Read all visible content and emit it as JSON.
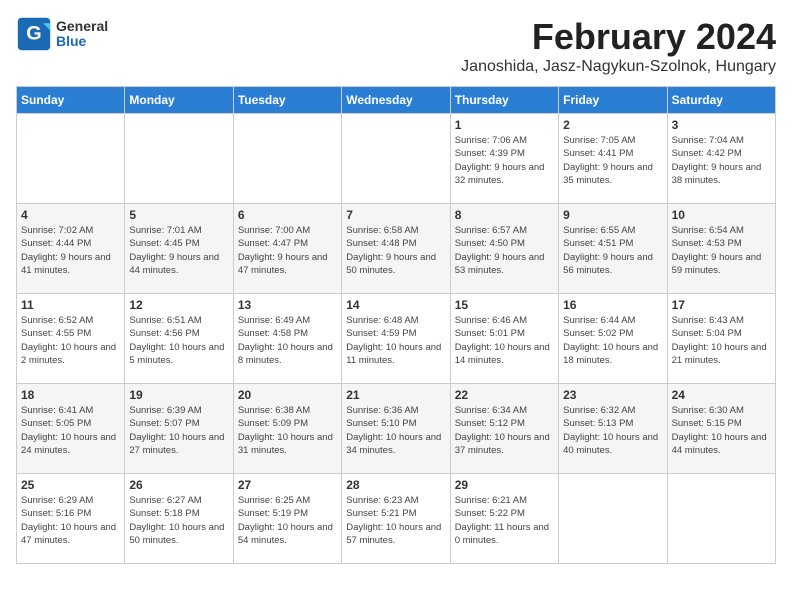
{
  "header": {
    "logo_general": "General",
    "logo_blue": "Blue",
    "month_title": "February 2024",
    "location": "Janoshida, Jasz-Nagykun-Szolnok, Hungary"
  },
  "days_of_week": [
    "Sunday",
    "Monday",
    "Tuesday",
    "Wednesday",
    "Thursday",
    "Friday",
    "Saturday"
  ],
  "weeks": [
    [
      {
        "day": "",
        "info": ""
      },
      {
        "day": "",
        "info": ""
      },
      {
        "day": "",
        "info": ""
      },
      {
        "day": "",
        "info": ""
      },
      {
        "day": "1",
        "info": "Sunrise: 7:06 AM\nSunset: 4:39 PM\nDaylight: 9 hours\nand 32 minutes."
      },
      {
        "day": "2",
        "info": "Sunrise: 7:05 AM\nSunset: 4:41 PM\nDaylight: 9 hours\nand 35 minutes."
      },
      {
        "day": "3",
        "info": "Sunrise: 7:04 AM\nSunset: 4:42 PM\nDaylight: 9 hours\nand 38 minutes."
      }
    ],
    [
      {
        "day": "4",
        "info": "Sunrise: 7:02 AM\nSunset: 4:44 PM\nDaylight: 9 hours\nand 41 minutes."
      },
      {
        "day": "5",
        "info": "Sunrise: 7:01 AM\nSunset: 4:45 PM\nDaylight: 9 hours\nand 44 minutes."
      },
      {
        "day": "6",
        "info": "Sunrise: 7:00 AM\nSunset: 4:47 PM\nDaylight: 9 hours\nand 47 minutes."
      },
      {
        "day": "7",
        "info": "Sunrise: 6:58 AM\nSunset: 4:48 PM\nDaylight: 9 hours\nand 50 minutes."
      },
      {
        "day": "8",
        "info": "Sunrise: 6:57 AM\nSunset: 4:50 PM\nDaylight: 9 hours\nand 53 minutes."
      },
      {
        "day": "9",
        "info": "Sunrise: 6:55 AM\nSunset: 4:51 PM\nDaylight: 9 hours\nand 56 minutes."
      },
      {
        "day": "10",
        "info": "Sunrise: 6:54 AM\nSunset: 4:53 PM\nDaylight: 9 hours\nand 59 minutes."
      }
    ],
    [
      {
        "day": "11",
        "info": "Sunrise: 6:52 AM\nSunset: 4:55 PM\nDaylight: 10 hours\nand 2 minutes."
      },
      {
        "day": "12",
        "info": "Sunrise: 6:51 AM\nSunset: 4:56 PM\nDaylight: 10 hours\nand 5 minutes."
      },
      {
        "day": "13",
        "info": "Sunrise: 6:49 AM\nSunset: 4:58 PM\nDaylight: 10 hours\nand 8 minutes."
      },
      {
        "day": "14",
        "info": "Sunrise: 6:48 AM\nSunset: 4:59 PM\nDaylight: 10 hours\nand 11 minutes."
      },
      {
        "day": "15",
        "info": "Sunrise: 6:46 AM\nSunset: 5:01 PM\nDaylight: 10 hours\nand 14 minutes."
      },
      {
        "day": "16",
        "info": "Sunrise: 6:44 AM\nSunset: 5:02 PM\nDaylight: 10 hours\nand 18 minutes."
      },
      {
        "day": "17",
        "info": "Sunrise: 6:43 AM\nSunset: 5:04 PM\nDaylight: 10 hours\nand 21 minutes."
      }
    ],
    [
      {
        "day": "18",
        "info": "Sunrise: 6:41 AM\nSunset: 5:05 PM\nDaylight: 10 hours\nand 24 minutes."
      },
      {
        "day": "19",
        "info": "Sunrise: 6:39 AM\nSunset: 5:07 PM\nDaylight: 10 hours\nand 27 minutes."
      },
      {
        "day": "20",
        "info": "Sunrise: 6:38 AM\nSunset: 5:09 PM\nDaylight: 10 hours\nand 31 minutes."
      },
      {
        "day": "21",
        "info": "Sunrise: 6:36 AM\nSunset: 5:10 PM\nDaylight: 10 hours\nand 34 minutes."
      },
      {
        "day": "22",
        "info": "Sunrise: 6:34 AM\nSunset: 5:12 PM\nDaylight: 10 hours\nand 37 minutes."
      },
      {
        "day": "23",
        "info": "Sunrise: 6:32 AM\nSunset: 5:13 PM\nDaylight: 10 hours\nand 40 minutes."
      },
      {
        "day": "24",
        "info": "Sunrise: 6:30 AM\nSunset: 5:15 PM\nDaylight: 10 hours\nand 44 minutes."
      }
    ],
    [
      {
        "day": "25",
        "info": "Sunrise: 6:29 AM\nSunset: 5:16 PM\nDaylight: 10 hours\nand 47 minutes."
      },
      {
        "day": "26",
        "info": "Sunrise: 6:27 AM\nSunset: 5:18 PM\nDaylight: 10 hours\nand 50 minutes."
      },
      {
        "day": "27",
        "info": "Sunrise: 6:25 AM\nSunset: 5:19 PM\nDaylight: 10 hours\nand 54 minutes."
      },
      {
        "day": "28",
        "info": "Sunrise: 6:23 AM\nSunset: 5:21 PM\nDaylight: 10 hours\nand 57 minutes."
      },
      {
        "day": "29",
        "info": "Sunrise: 6:21 AM\nSunset: 5:22 PM\nDaylight: 11 hours\nand 0 minutes."
      },
      {
        "day": "",
        "info": ""
      },
      {
        "day": "",
        "info": ""
      }
    ]
  ]
}
